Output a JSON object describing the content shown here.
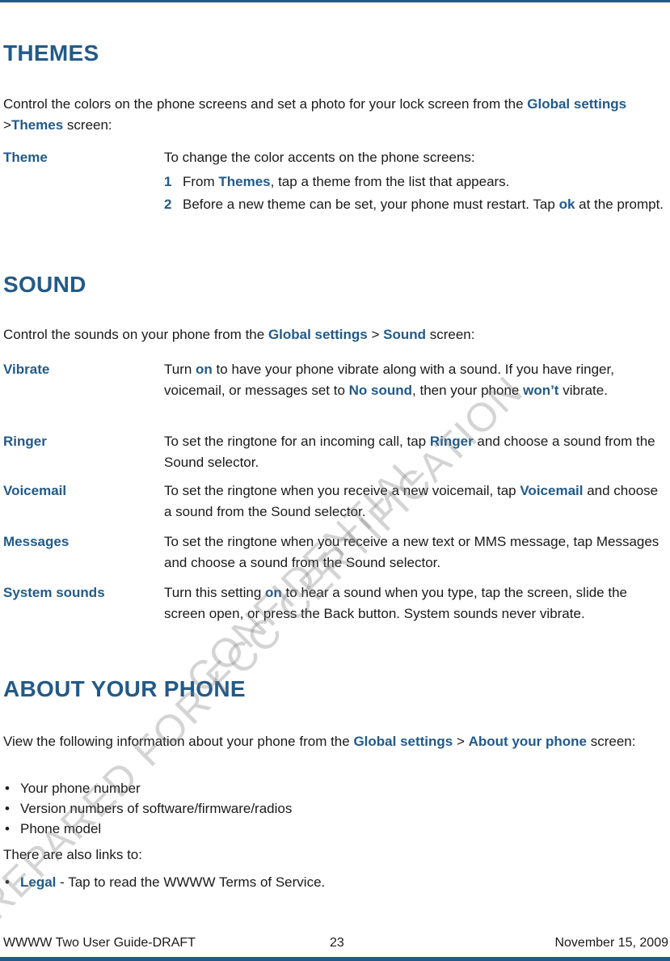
{
  "colors": {
    "accent": "#235a87",
    "text": "#1a1a1a",
    "watermark": "#9a9a9a"
  },
  "themes": {
    "heading": "THEMES",
    "intro_pre": "Control the colors on the phone screens and set a photo for your lock screen from the ",
    "intro_link1": "Global settings",
    "intro_sep": " >",
    "intro_link2": "Themes",
    "intro_post": " screen:",
    "rows": [
      {
        "term": "Theme",
        "desc": "To change the color accents on the phone screens:",
        "steps": [
          {
            "num": "1",
            "pre": "From ",
            "link": "Themes",
            "post": ", tap a theme from the list that appears."
          },
          {
            "num": "2",
            "pre": "Before a new theme can be set, your phone must restart. Tap ",
            "link": "ok",
            "post": " at the prompt."
          }
        ]
      }
    ]
  },
  "sound": {
    "heading": "SOUND",
    "intro_pre": "Control the sounds on your phone from the ",
    "intro_link1": "Global settings",
    "intro_sep": " > ",
    "intro_link2": "Sound",
    "intro_post": " screen:",
    "rows": [
      {
        "term": "Vibrate",
        "parts": [
          "Turn ",
          "on",
          " to have your phone vibrate along with a sound. If you have ringer, voicemail, or messages set to ",
          "No sound",
          ", then your phone ",
          "won’t",
          " vibrate."
        ]
      },
      {
        "term": "Ringer",
        "parts": [
          "To set the ringtone for an incoming call, tap ",
          "Ringer",
          " and choose a sound from the Sound selector."
        ]
      },
      {
        "term": "Voicemail",
        "parts": [
          "To set the ringtone when you receive a new voicemail, tap ",
          "Voicemail",
          " and choose a sound from the Sound selector."
        ]
      },
      {
        "term": "Messages",
        "parts": [
          "To set the ringtone when you receive a new text or MMS message, tap Messages and choose a sound from the Sound selector."
        ]
      },
      {
        "term": "System sounds",
        "parts": [
          "Turn this setting ",
          "on",
          " to hear a sound when you type, tap the screen, slide the screen open, or press the Back button. System sounds never vibrate."
        ]
      }
    ]
  },
  "about": {
    "heading": "ABOUT YOUR PHONE",
    "intro_pre": "View the following information about your phone from the ",
    "intro_link1": "Global settings",
    "intro_sep": " > ",
    "intro_link2": "About your phone",
    "intro_post": " screen:",
    "bullets": [
      "Your phone number",
      "Version numbers of software/firmware/radios",
      "Phone model"
    ],
    "links_intro": "There are also links to:",
    "links": [
      {
        "link": "Legal",
        "post": " - Tap to read the WWWW Terms of Service."
      }
    ]
  },
  "footer": {
    "left": "WWWW Two User Guide-DRAFT",
    "page": "23",
    "date": "November 15, 2009"
  },
  "watermark": {
    "line1": "PREPARED FOR FCC CERTIFICATION",
    "line2": "CONFIDENTIAL"
  }
}
